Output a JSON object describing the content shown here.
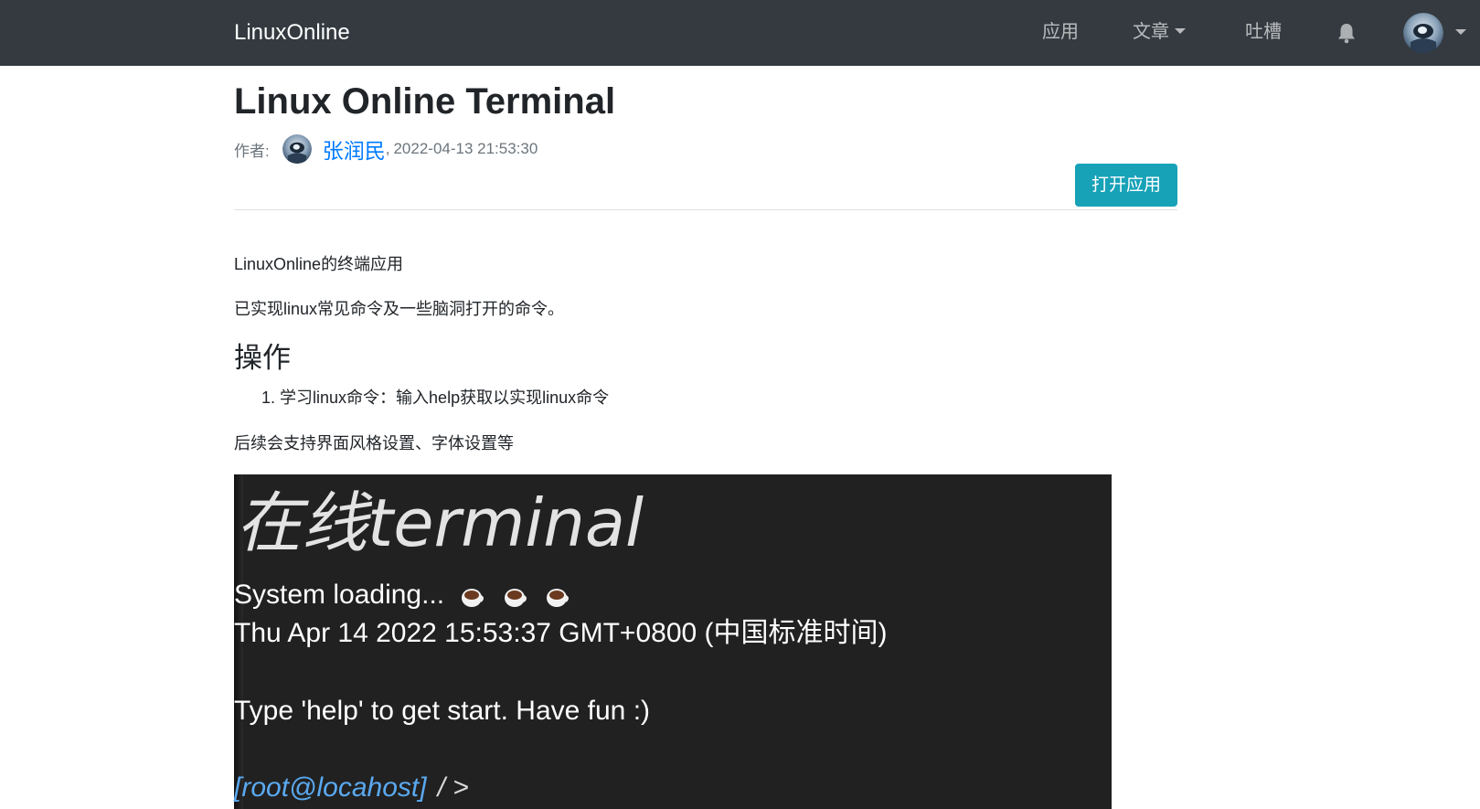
{
  "navbar": {
    "brand": "LinuxOnline",
    "items": {
      "apps": "应用",
      "articles": "文章",
      "tucao": "吐槽"
    },
    "icons": {
      "bell": "bell-icon",
      "avatar": "user-avatar",
      "avatar_menu": "chevron-down-icon"
    },
    "colors": {
      "background": "#343a40",
      "brand_text": "#ffffff",
      "item_text": "rgba(255,255,255,0.65)"
    }
  },
  "article": {
    "title": "Linux Online Terminal",
    "meta": {
      "author_label": "作者:",
      "author_name": "张润民",
      "separator": ",",
      "datetime": "2022-04-13 21:53:30"
    },
    "open_button": "打开应用",
    "paragraphs": {
      "intro": "LinuxOnline的终端应用",
      "implemented": "已实现linux常见命令及一些脑洞打开的命令。",
      "followup": "后续会支持界面风格设置、字体设置等"
    },
    "operations": {
      "heading": "操作",
      "items": [
        {
          "number": "1.",
          "text": "学习linux命令：输入help获取以实现linux命令"
        }
      ]
    },
    "colors": {
      "link": "#007bff",
      "button": "#17a2b8",
      "muted": "#6c757d"
    }
  },
  "terminal": {
    "heading": "在线terminal",
    "loading": "System loading...",
    "loading_icons": [
      "coffee-cup-icon",
      "coffee-cup-icon",
      "coffee-cup-icon"
    ],
    "date": "Thu Apr 14 2022 15:53:37 GMT+0800 (中国标准时间)",
    "help": "Type 'help' to get start. Have fun :)",
    "prompt": "[root@locahost]",
    "prompt_symbol": "/ >",
    "colors": {
      "background": "#212121",
      "prompt": "#5aa9f0"
    }
  }
}
